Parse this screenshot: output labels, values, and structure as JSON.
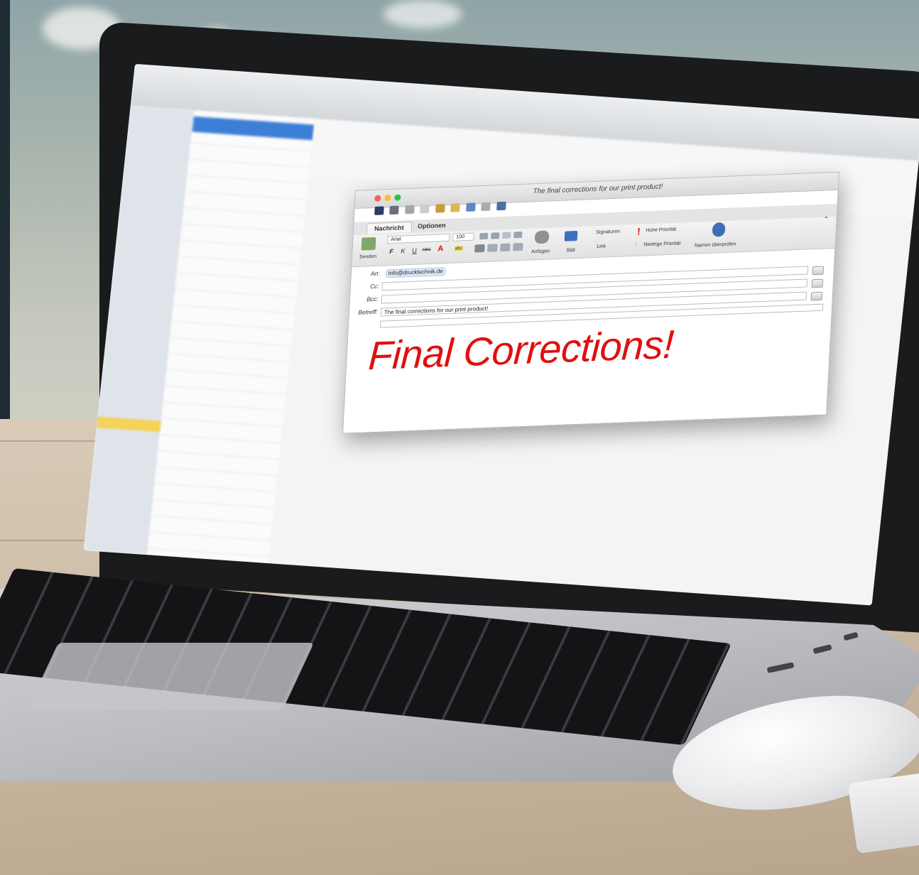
{
  "compose": {
    "window_title": "The final corrections for our print product!",
    "tabs": [
      "Nachricht",
      "Optionen"
    ],
    "ribbon": {
      "send_label": "Senden",
      "font_name": "Arial",
      "font_size": "100",
      "bold": "F",
      "italic": "K",
      "underline": "U",
      "strike": "ABC",
      "font_color": "A",
      "highlight": "abc",
      "attach_label": "Anfügen",
      "image_label": "Bild",
      "signatures_label": "Signaturen",
      "link_label": "Link",
      "high_priority_label": "Hohe Priorität",
      "low_priority_label": "Niedrige Priorität",
      "check_names_label": "Namen überprüfen"
    },
    "to_label": "An:",
    "to_value": "info@drucktechnik.de",
    "cc_label": "Cc:",
    "bcc_label": "Bcc:",
    "subject_label": "Betreff:",
    "subject_value": "The final corrections for our print product!",
    "body_text": "Final Corrections!"
  },
  "colors": {
    "body_text": "#e0100f",
    "selection": "#3d7fd6",
    "close_light": "#ff5f57",
    "min_light": "#febc2e",
    "max_light": "#28c840"
  }
}
